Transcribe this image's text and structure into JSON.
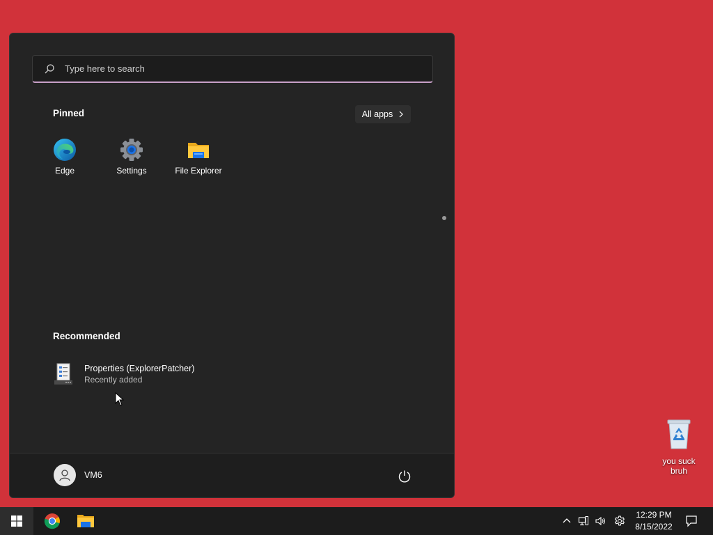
{
  "start_menu": {
    "search_placeholder": "Type here to search",
    "pinned_title": "Pinned",
    "all_apps_label": "All apps",
    "pinned_apps": [
      {
        "label": "Edge",
        "icon": "edge-icon"
      },
      {
        "label": "Settings",
        "icon": "gear-icon"
      },
      {
        "label": "File Explorer",
        "icon": "folder-icon"
      }
    ],
    "recommended_title": "Recommended",
    "recommended": [
      {
        "name": "Properties (ExplorerPatcher)",
        "subtitle": "Recently added",
        "icon": "properties-file-icon"
      }
    ],
    "user_name": "VM6"
  },
  "desktop": {
    "background_color": "#d1323a",
    "icons": [
      {
        "label": "you suck bruh",
        "icon": "recycle-bin-icon"
      }
    ]
  },
  "taskbar": {
    "pinned": [
      "chrome-icon",
      "file-explorer-icon"
    ],
    "clock_time": "12:29 PM",
    "clock_date": "8/15/2022"
  }
}
